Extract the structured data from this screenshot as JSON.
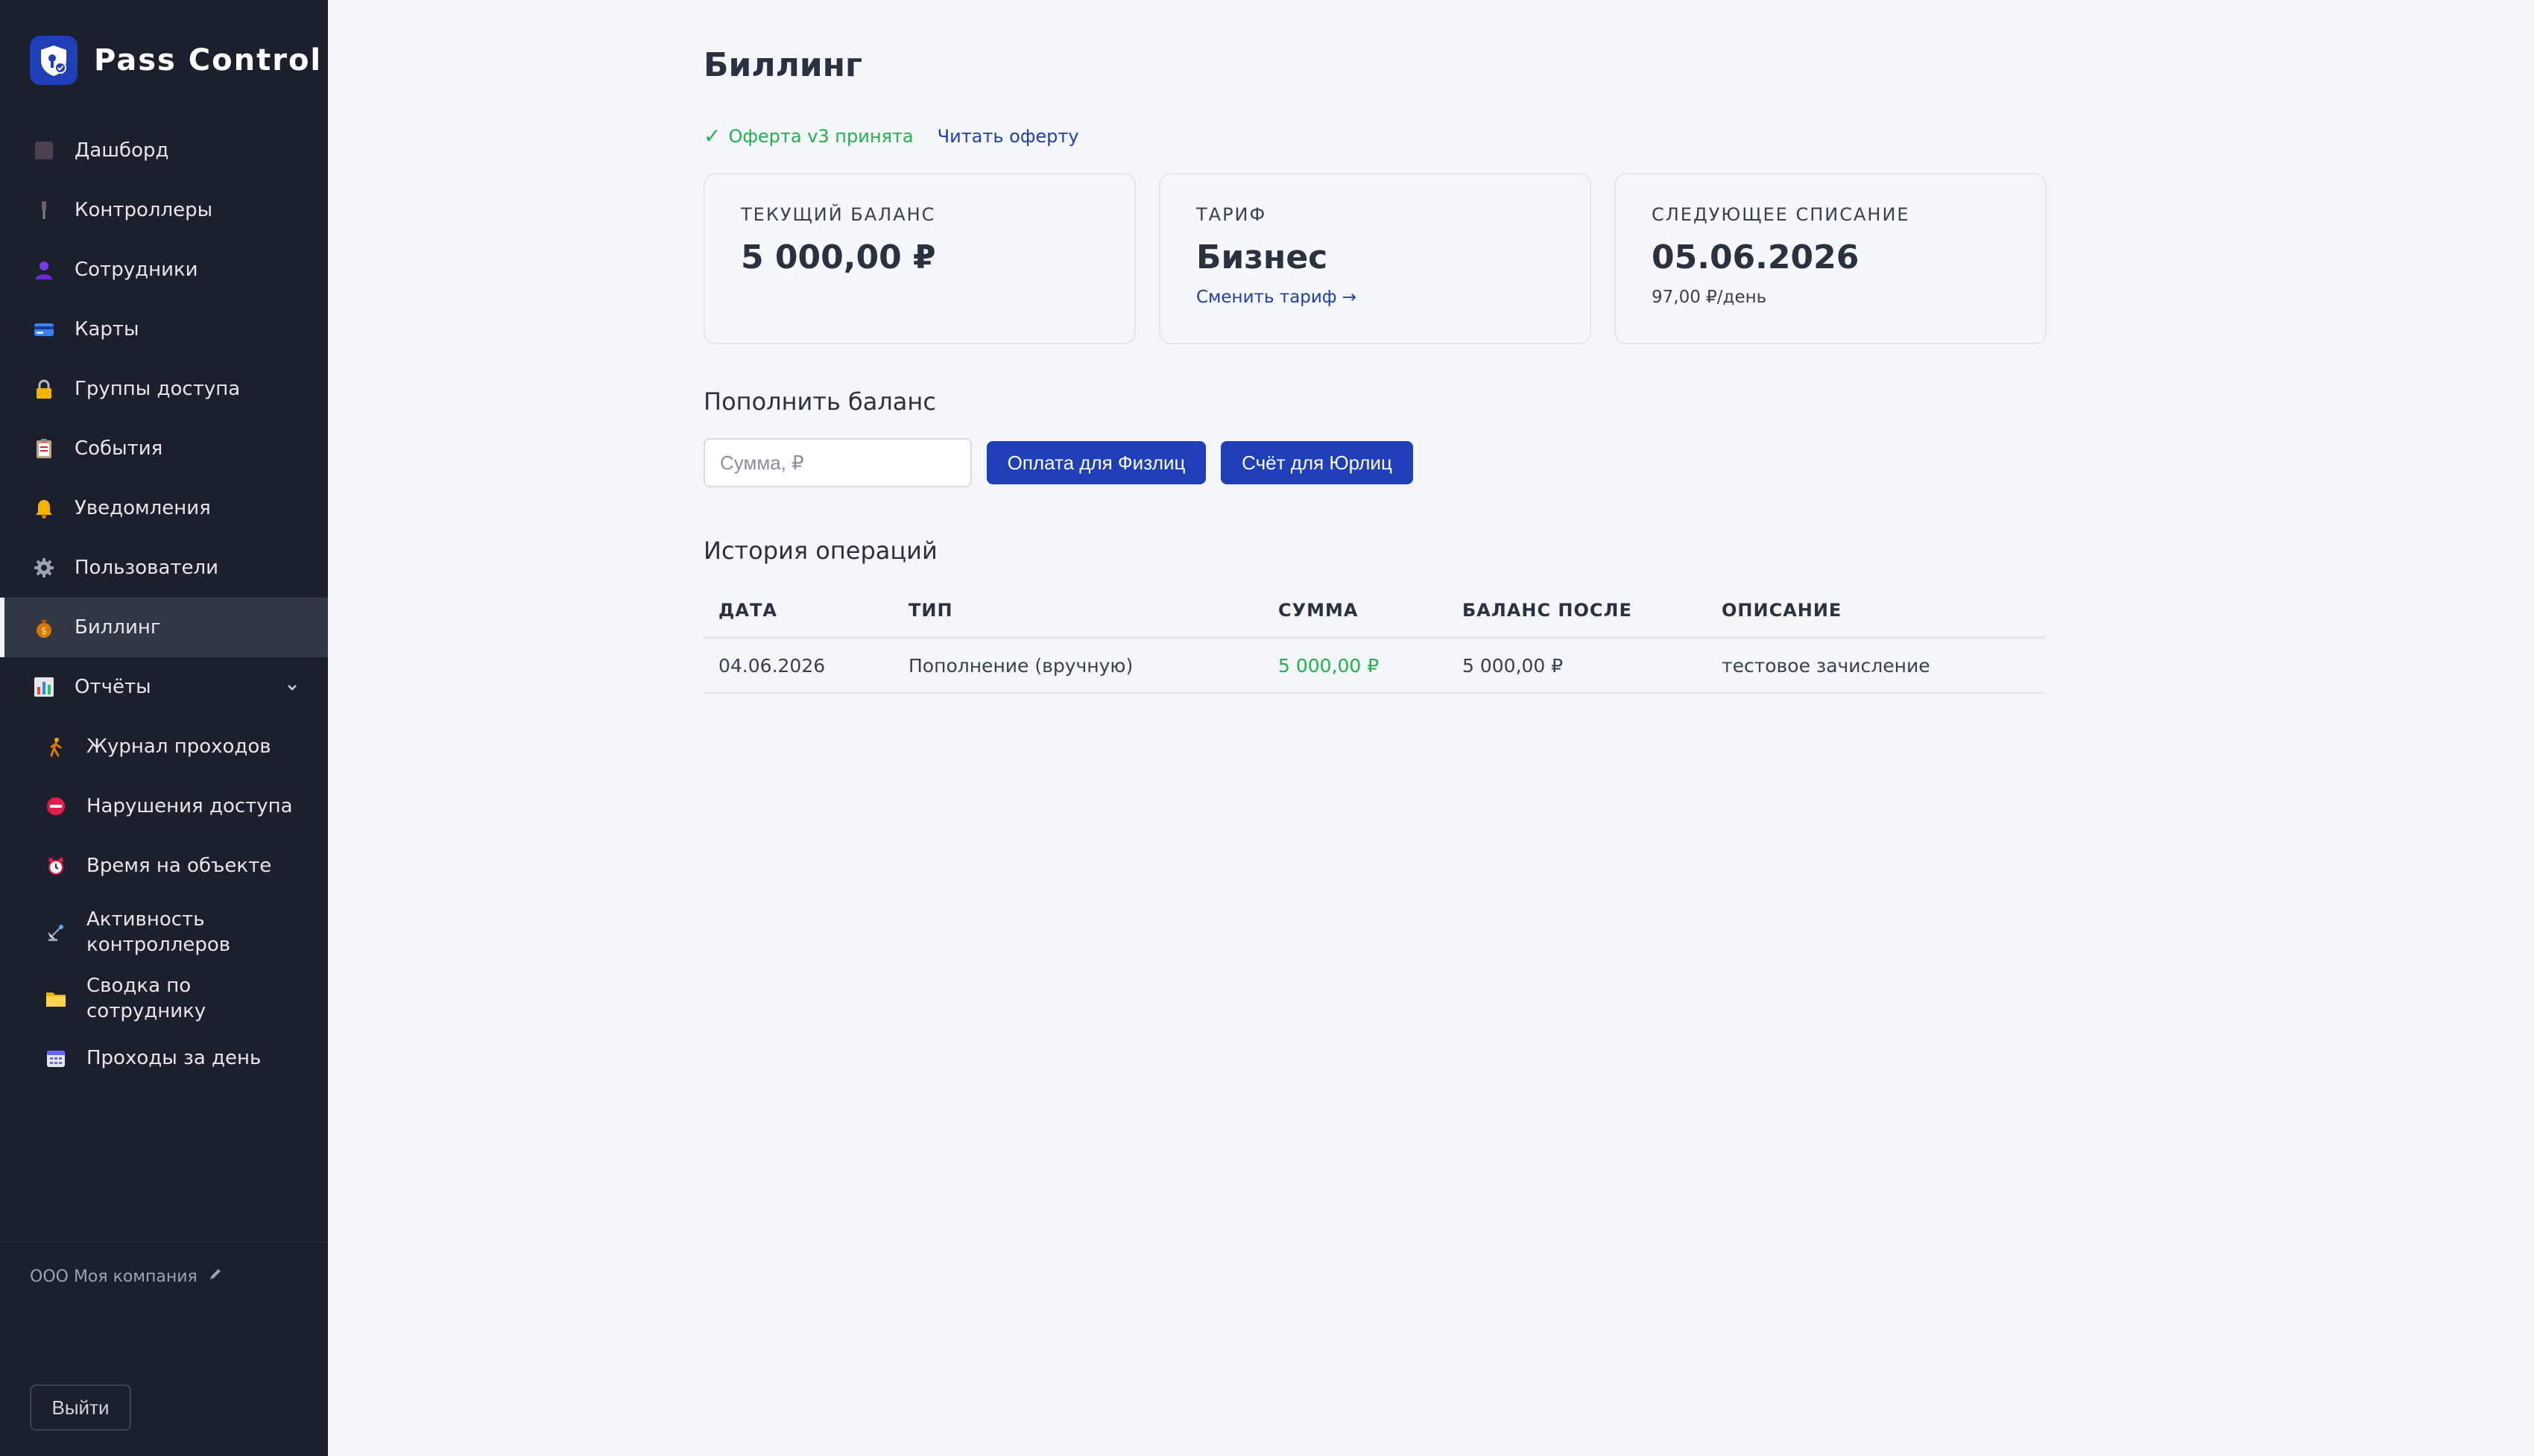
{
  "app": {
    "title": "Pass Control"
  },
  "sidebar": {
    "items": [
      {
        "label": "Дашборд",
        "icon": "dashboard-icon"
      },
      {
        "label": "Контроллеры",
        "icon": "controller-icon"
      },
      {
        "label": "Сотрудники",
        "icon": "user-icon"
      },
      {
        "label": "Карты",
        "icon": "card-icon"
      },
      {
        "label": "Группы доступа",
        "icon": "lock-icon"
      },
      {
        "label": "События",
        "icon": "clipboard-icon"
      },
      {
        "label": "Уведомления",
        "icon": "bell-icon"
      },
      {
        "label": "Пользователи",
        "icon": "gear-icon"
      },
      {
        "label": "Биллинг",
        "icon": "money-bag-icon",
        "active": true
      },
      {
        "label": "Отчёты",
        "icon": "bar-chart-icon",
        "expanded": true
      }
    ],
    "reports": [
      {
        "label": "Журнал проходов",
        "icon": "walking-person-icon"
      },
      {
        "label": "Нарушения доступа",
        "icon": "no-entry-icon"
      },
      {
        "label": "Время на объекте",
        "icon": "alarm-clock-icon"
      },
      {
        "label": "Активность контроллеров",
        "icon": "satellite-icon"
      },
      {
        "label": "Сводка по сотруднику",
        "icon": "folder-icon"
      },
      {
        "label": "Проходы за день",
        "icon": "calendar-icon"
      }
    ],
    "company": "ООО Моя компания",
    "logout": "Выйти"
  },
  "page": {
    "title": "Биллинг",
    "offer_status": "Оферта v3 принята",
    "offer_link": "Читать оферту"
  },
  "cards": {
    "balance": {
      "label": "ТЕКУЩИЙ БАЛАНС",
      "value": "5 000,00 ₽"
    },
    "tariff": {
      "label": "ТАРИФ",
      "value": "Бизнес",
      "action": "Сменить тариф →"
    },
    "next_charge": {
      "label": "СЛЕДУЮЩЕЕ СПИСАНИЕ",
      "value": "05.06.2026",
      "sub": "97,00 ₽/день"
    }
  },
  "topup": {
    "title": "Пополнить баланс",
    "placeholder": "Сумма, ₽",
    "btn_individual": "Оплата для Физлиц",
    "btn_legal": "Счёт для Юрлиц"
  },
  "history": {
    "title": "История операций",
    "columns": [
      "ДАТА",
      "ТИП",
      "СУММА",
      "БАЛАНС ПОСЛЕ",
      "ОПИСАНИЕ"
    ],
    "rows": [
      [
        "04.06.2026",
        "Пополнение (вручную)",
        "5 000,00 ₽",
        "5 000,00 ₽",
        "тестовое зачисление"
      ]
    ]
  },
  "colors": {
    "sidebar_bg": "#1c1f2c",
    "accent": "#1e3fb8",
    "success": "#22b14c",
    "link": "#1e40af"
  }
}
